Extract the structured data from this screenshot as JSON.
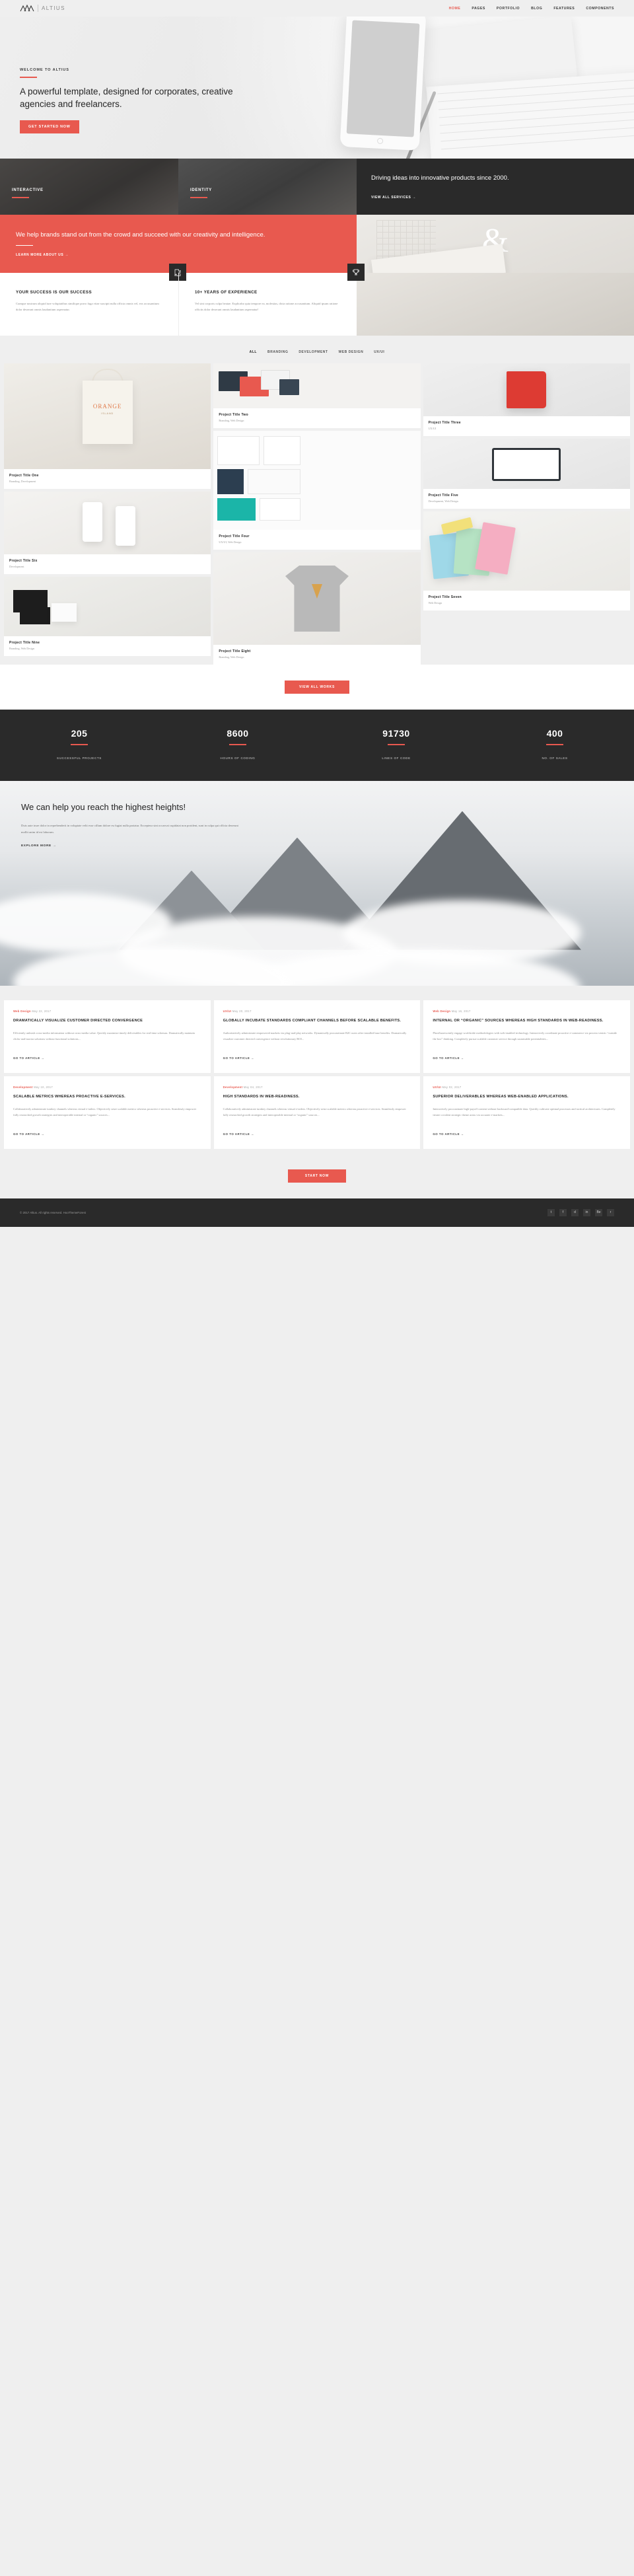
{
  "header": {
    "brand": "ALTIUS",
    "logo_icon": "mountain-icon",
    "nav": [
      {
        "label": "HOME",
        "active": true
      },
      {
        "label": "PAGES",
        "active": false
      },
      {
        "label": "PORTFOLIO",
        "active": false
      },
      {
        "label": "BLOG",
        "active": false
      },
      {
        "label": "FEATURES",
        "active": false
      },
      {
        "label": "COMPONENTS",
        "active": false
      }
    ]
  },
  "hero": {
    "eyebrow": "WELCOME TO ALTIUS",
    "title": "A powerful template, designed for corporates, creative agencies and freelancers.",
    "cta": "GET STARTED NOW"
  },
  "services": {
    "tiles": [
      {
        "label": "INTERACTIVE"
      },
      {
        "label": "IDENTITY"
      }
    ],
    "panel": {
      "title": "Driving ideas into innovative products since 2000.",
      "link": "VIEW ALL SERVICES  →"
    }
  },
  "promo": {
    "title": "We help brands stand out from the crowd and succeed with our creativity and intelligence.",
    "link": "LEARN MORE ABOUT US  →",
    "ampersand": "&"
  },
  "features": [
    {
      "icon": "puzzle-icon",
      "title": "YOUR SUCCESS IS OUR SUCCESS",
      "text": "Cumque nostrum aliquid iure voluptatibus similique porro fuga vitae suscipit nulla officia omnis vel, eos accusantium dolor deserunt omnis laudantium aspernatur."
    },
    {
      "icon": "trophy-icon",
      "title": "10+ YEARS OF EXPERIENCE",
      "text": "Vel sint corporis culpa beatae. Explicabo quia tempore ea, molestias, dicta ratione accusantium. Aliquid ipsam ratione officiis dolor deserunt omnis laudantium aspernatur!"
    }
  ],
  "portfolio": {
    "filters": [
      {
        "label": "ALL",
        "active": true
      },
      {
        "label": "BRANDING",
        "active": false
      },
      {
        "label": "DEVELOPMENT",
        "active": false
      },
      {
        "label": "WEB DESIGN",
        "active": false
      },
      {
        "label": "UX/UI",
        "active": false
      }
    ],
    "items": [
      {
        "title": "Project Title One",
        "cat": "Branding, Development"
      },
      {
        "title": "Project Title Two",
        "cat": "Branding, Web Design"
      },
      {
        "title": "Project Title Three",
        "cat": "UX/UI"
      },
      {
        "title": "Project Title Four",
        "cat": "UX/UI, Web Design"
      },
      {
        "title": "Project Title Five",
        "cat": "Development, Web Design"
      },
      {
        "title": "Project Title Six",
        "cat": "Development"
      },
      {
        "title": "Project Title Seven",
        "cat": "Web Design"
      },
      {
        "title": "Project Title Eight",
        "cat": "Branding, Web Design"
      },
      {
        "title": "Project Title Nine",
        "cat": "Branding, Web Design"
      }
    ],
    "more": "VIEW ALL WORKS"
  },
  "chart_data": {
    "type": "bar",
    "title": "Company counters",
    "categories": [
      "SUCCESSFUL PROJECTS",
      "HOURS OF CODING",
      "LINES OF CODE",
      "NO. OF SALES"
    ],
    "values": [
      205,
      8600,
      91730,
      400
    ],
    "xlabel": "",
    "ylabel": "",
    "grid": false,
    "legend": "none"
  },
  "stats": [
    {
      "value": "205",
      "label": "SUCCESSFUL PROJECTS"
    },
    {
      "value": "8600",
      "label": "HOURS OF CODING"
    },
    {
      "value": "91730",
      "label": "LINES OF CODE"
    },
    {
      "value": "400",
      "label": "NO. OF SALES"
    }
  ],
  "mountain": {
    "title": "We can help you reach the highest heights!",
    "text": "Duis aute irure dolor in reprehenderit in voluptate velit esse cillum dolore eu fugiat nulla pariatur. Excepteur sint occaecat cupidatat non proident, sunt in culpa qui officia deserunt mollit anim id est laborum.",
    "link": "EXPLORE MORE  →"
  },
  "blog": {
    "posts": [
      {
        "cat": "Web Design",
        "date": "May 22, 2017",
        "title": "DRAMATICALLY VISUALIZE CUSTOMER DIRECTED CONVERGENCE",
        "text": "Efficiently unleash cross-media information without cross-media value. Quickly maximize timely deliverables for real-time schemas. Dramatically maintain clicks-and-mortar solutions without functional solutions...",
        "link": "GO TO ARTICLE  →"
      },
      {
        "cat": "UX/UI",
        "date": "May 20, 2017",
        "title": "GLOBALLY INCUBATE STANDARDS COMPLIANT CHANNELS BEFORE SCALABLE BENEFITS.",
        "text": "Authoritatively administrate empowered markets via plug-and-play networks. Dynamically procrastinate B2C users after installed base benefits. Dramatically visualize customer directed convergence without revolutionary ROI...",
        "link": "GO TO ARTICLE  →"
      },
      {
        "cat": "Web Design",
        "date": "May 16, 2017",
        "title": "INTERNAL OR “ORGANIC” SOURCES WHEREAS HIGH STANDARDS IN WEB-READINESS.",
        "text": "Phosfluorescently engage worldwide methodologies with web-enabled technology. Interactively coordinate proactive e-commerce via process-centric “outside the box” thinking. Completely pursue scalable customer service through sustainable potentialities...",
        "link": "GO TO ARTICLE  →"
      },
      {
        "cat": "Development",
        "date": "May 10, 2017",
        "title": "SCALABLE METRICS WHEREAS PROACTIVE E-SERVICES.",
        "text": "Collaboratively administrate turnkey channels whereas virtual e-tailers. Objectively seize scalable metrics whereas proactive e-services. Seamlessly empower fully researched growth strategies and interoperable internal or “organic” sources...",
        "link": "GO TO ARTICLE  →"
      },
      {
        "cat": "Development",
        "date": "May 04, 2017",
        "title": "HIGH STANDARDS IN WEB-READINESS.",
        "text": "Collaboratively administrate turnkey channels whereas virtual e-tailers. Objectively seize scalable metrics whereas proactive e-services. Seamlessly empower fully researched growth strategies and interoperable internal or “organic” sources...",
        "link": "GO TO ARTICLE  →"
      },
      {
        "cat": "UX/UI",
        "date": "May 02, 2017",
        "title": "SUPERIOR DELIVERABLES WHEREAS WEB-ENABLED APPLICATIONS.",
        "text": "Interactively procrastinate high-payoff content without backward-compatible data. Quickly cultivate optimal processes and tactical architectures. Completely iterate covalent strategic theme areas via accurate e-markets...",
        "link": "GO TO ARTICLE  →"
      }
    ]
  },
  "bottom_cta": {
    "label": "START NOW"
  },
  "footer": {
    "copyright": "© 2017 Altius. All rights reserved. HooThemeForest",
    "socials": [
      {
        "name": "twitter-icon",
        "glyph": "t"
      },
      {
        "name": "facebook-icon",
        "glyph": "f"
      },
      {
        "name": "dribbble-icon",
        "glyph": "d"
      },
      {
        "name": "linkedin-icon",
        "glyph": "in"
      },
      {
        "name": "behance-icon",
        "glyph": "Be"
      },
      {
        "name": "rss-icon",
        "glyph": "r"
      }
    ]
  },
  "colors": {
    "accent": "#e8594f",
    "dark": "#2a2a2a",
    "bg": "#efefef"
  }
}
